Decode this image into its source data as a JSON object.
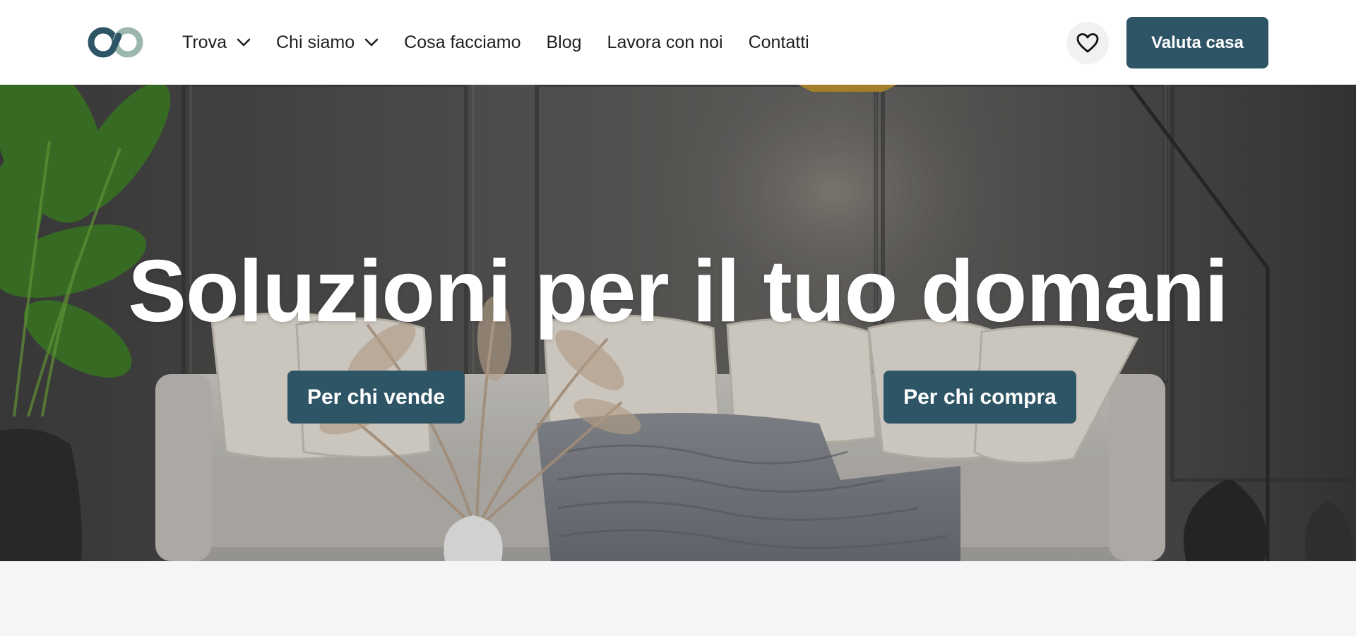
{
  "header": {
    "logo_icon": "infinity-rings-logo",
    "nav": [
      {
        "label": "Trova",
        "has_dropdown": true
      },
      {
        "label": "Chi siamo",
        "has_dropdown": true
      },
      {
        "label": "Cosa facciamo",
        "has_dropdown": false
      },
      {
        "label": "Blog",
        "has_dropdown": false
      },
      {
        "label": "Lavora con noi",
        "has_dropdown": false
      },
      {
        "label": "Contatti",
        "has_dropdown": false
      }
    ],
    "favorites_icon": "heart-icon",
    "cta_label": "Valuta casa"
  },
  "hero": {
    "title": "Soluzioni per il tuo domani",
    "buttons": {
      "sell_label": "Per chi vende",
      "buy_label": "Per chi compra"
    },
    "background": "living-room-sofa-photo"
  },
  "colors": {
    "accent": "#2e5566",
    "logo_dark": "#2e5566",
    "logo_light": "#9bb7ae",
    "header_bg": "#ffffff",
    "page_bg": "#f5f5f7"
  }
}
